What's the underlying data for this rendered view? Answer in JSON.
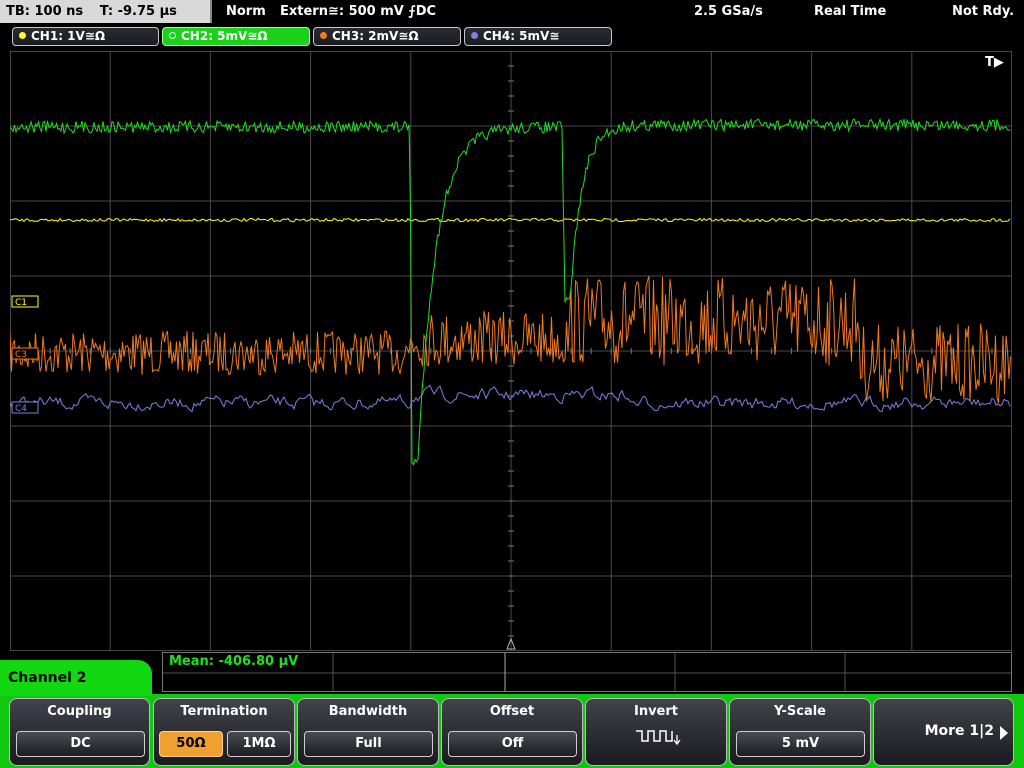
{
  "status": {
    "timebase": "TB: 100 ns",
    "trigger_time": "T: -9.75 µs",
    "trigger_mode": "Norm",
    "trigger_source": "Extern≅: 500 mV ⨍DC",
    "sample_rate": "2.5 GSa/s",
    "acq_mode": "Real Time",
    "ready_state": "Not Rdy."
  },
  "channels": [
    {
      "label": "CH1: 1V≅Ω",
      "color": "#ffff22"
    },
    {
      "label": "CH2: 5mV≅Ω",
      "color": "#1ad21a"
    },
    {
      "label": "CH3: 2mV≅Ω",
      "color": "#f07a1e"
    },
    {
      "label": "CH4: 5mV≅",
      "color": "#7f7fe0"
    }
  ],
  "scope": {
    "trigger_marker": "T▶",
    "ch_markers": [
      "C1",
      "C3",
      "C4"
    ],
    "colors": {
      "grid": "#4a4a4a",
      "ch1": "#ffff22",
      "ch2": "#22dd22",
      "ch3": "#f07a1e",
      "ch4": "#7f7fe0"
    }
  },
  "measurement": {
    "text": "Mean: -406.80 µV"
  },
  "menu": {
    "channel_title": "Channel 2",
    "coupling": {
      "title": "Coupling",
      "value": "DC"
    },
    "termination": {
      "title": "Termination",
      "opt1": "50Ω",
      "opt2": "1MΩ"
    },
    "bandwidth": {
      "title": "Bandwidth",
      "value": "Full"
    },
    "offset": {
      "title": "Offset",
      "value": "Off"
    },
    "invert": {
      "title": "Invert",
      "icon": "inverted-square-wave-icon"
    },
    "yscale": {
      "title": "Y-Scale",
      "value": "5 mV"
    },
    "more": {
      "label": "More 1|2",
      "icon": "arrow-right-icon"
    }
  }
}
